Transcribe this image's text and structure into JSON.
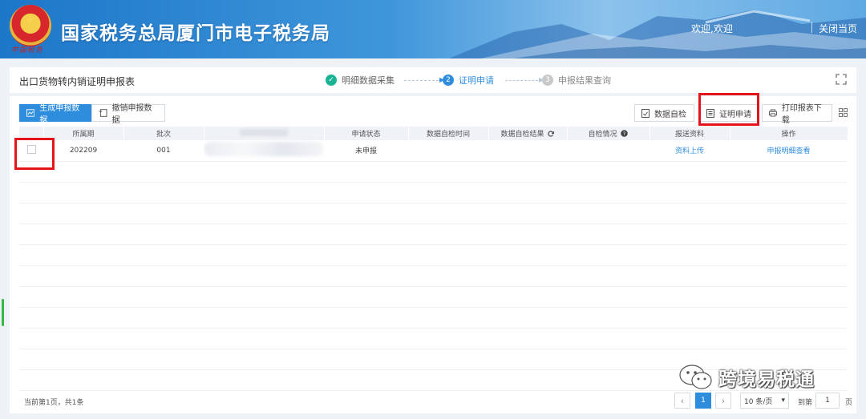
{
  "header": {
    "site_title": "国家税务总局厦门市电子税务局",
    "emblem_caption": "中国税务",
    "welcome": "欢迎,欢迎",
    "close_page": "关闭当页"
  },
  "stepbar": {
    "page_title": "出口货物转内销证明申报表",
    "steps": [
      {
        "num": "✓",
        "label": "明细数据采集",
        "state": "done"
      },
      {
        "num": "2",
        "label": "证明申请",
        "state": "active"
      },
      {
        "num": "3",
        "label": "申报结果查询",
        "state": "pending"
      }
    ]
  },
  "toolbar": {
    "generate": "生成申报数据",
    "cancel": "撤销申报数据",
    "self_check": "数据自检",
    "cert_apply": "证明申请",
    "print": "打印报表下载"
  },
  "table": {
    "headers": [
      "",
      "所属期",
      "批次",
      "",
      "申请状态",
      "数据自检时间",
      "数据自检结果",
      "自检情况",
      "报送资料",
      "操作"
    ],
    "rows": [
      {
        "period": "202209",
        "batch": "001",
        "status": "未申报",
        "check_time": "",
        "check_result": "",
        "check_status": "",
        "docs": "资料上传",
        "action": "申报明细查看"
      }
    ]
  },
  "pagination": {
    "summary": "当前第1页，共1条",
    "prev": "‹",
    "current": "1",
    "next": "›",
    "page_size": "10 条/页",
    "goto_label": "到第",
    "goto_value": "1",
    "goto_unit": "页"
  },
  "watermark": "跨境易税通",
  "colors": {
    "accent": "#2f8ddd",
    "highlight": "#e3141c",
    "done": "#19b394"
  }
}
